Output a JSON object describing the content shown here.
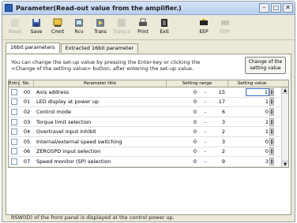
{
  "window": {
    "title": "Parameter(Read-out value from the amplifier.)"
  },
  "toolbar": {
    "buttons": [
      {
        "label": "Reset",
        "enabled": false
      },
      {
        "label": "Save",
        "enabled": true
      },
      {
        "label": "Cmnt",
        "enabled": true
      },
      {
        "label": "Rcv",
        "enabled": true
      },
      {
        "label": "Trans",
        "enabled": true
      },
      {
        "label": "Trans a",
        "enabled": false
      },
      {
        "label": "Print",
        "enabled": true
      },
      {
        "label": "Exit",
        "enabled": true
      },
      {
        "label": "EEP",
        "enabled": true
      },
      {
        "label": "EEPr",
        "enabled": false
      }
    ]
  },
  "tabs": [
    {
      "label": "16bit parameters",
      "active": true
    },
    {
      "label": "Extracted 16bit parameter",
      "active": false
    }
  ],
  "instructions": "You can change the set-up value by pressing the Enter-key or clicking the <Change of the setting value> button, after entering the set-up value.",
  "change_button": "Change of the setting value",
  "grid": {
    "headers": {
      "entry": "Entry",
      "no": "No.",
      "title": "Parameter title",
      "range": "Setting range",
      "value": "Setting value"
    },
    "rows": [
      {
        "no": "00",
        "title": "Axis address",
        "min": "0",
        "max": "15",
        "value": "1"
      },
      {
        "no": "01",
        "title": "LED display at power up",
        "min": "0",
        "max": "17",
        "value": "1"
      },
      {
        "no": "02",
        "title": "Control mode",
        "min": "0",
        "max": "6",
        "value": "0"
      },
      {
        "no": "03",
        "title": "Torque limit selection",
        "min": "0",
        "max": "3",
        "value": "1"
      },
      {
        "no": "04",
        "title": "Overtravel input inhibit",
        "min": "0",
        "max": "2",
        "value": "1"
      },
      {
        "no": "05",
        "title": "Internal/external speed switching",
        "min": "0",
        "max": "3",
        "value": "0"
      },
      {
        "no": "06",
        "title": "ZEROSPD input selection",
        "min": "0",
        "max": "2",
        "value": "0"
      },
      {
        "no": "07",
        "title": "Speed monitor (SP) selection",
        "min": "0",
        "max": "9",
        "value": "3"
      }
    ]
  },
  "status_text": "RSW(ID) of the front panel is displayed at the control power up."
}
